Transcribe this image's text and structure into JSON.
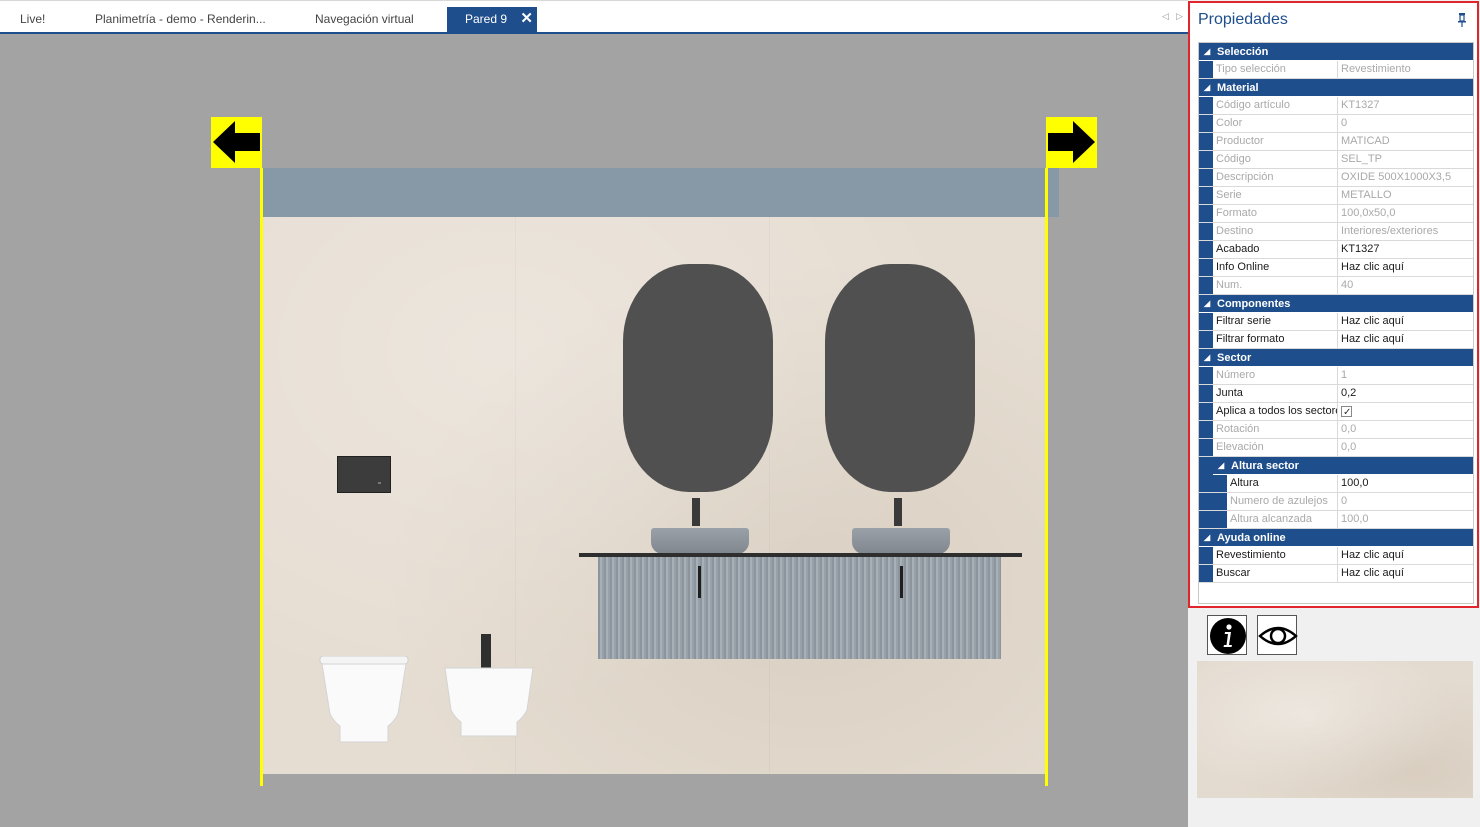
{
  "tabs": [
    {
      "label": "Live!"
    },
    {
      "label": "Planimetría - demo - Renderin..."
    },
    {
      "label": "Navegación virtual"
    },
    {
      "label": "Pared 9",
      "active": true
    }
  ],
  "tab_close_glyph": "✕",
  "scroll_glyphs": {
    "left": "◁",
    "right": "▷"
  },
  "colors": {
    "accent": "#1f4e8c",
    "highlight_border": "#e0262c",
    "guide_yellow": "#ffff00",
    "viewport_bg": "#a3a3a3",
    "wall_tile": "#e6ddd2",
    "wall_band": "#8798a6"
  },
  "panel": {
    "title": "Propiedades",
    "pin_icon": "pin-icon",
    "sections": [
      {
        "title": "Selección",
        "rows": [
          {
            "label": "Tipo selección",
            "value": "Revestimiento",
            "disabled": true
          }
        ]
      },
      {
        "title": "Material",
        "rows": [
          {
            "label": "Código artículo",
            "value": "KT1327",
            "disabled": true
          },
          {
            "label": "Color",
            "value": "0",
            "disabled": true
          },
          {
            "label": "Productor",
            "value": "MATICAD",
            "disabled": true
          },
          {
            "label": "Código",
            "value": "SEL_TP",
            "disabled": true
          },
          {
            "label": "Descripción",
            "value": "OXIDE 500X1000X3,5",
            "disabled": true
          },
          {
            "label": "Serie",
            "value": "METALLO",
            "disabled": true
          },
          {
            "label": "Formato",
            "value": "100,0x50,0",
            "disabled": true
          },
          {
            "label": "Destino",
            "value": "Interiores/exteriores",
            "disabled": true
          },
          {
            "label": "Acabado",
            "value": "KT1327",
            "disabled": false
          },
          {
            "label": "Info Online",
            "value": "Haz clic aquí",
            "disabled": false
          },
          {
            "label": "Num.",
            "value": "40",
            "disabled": true
          }
        ]
      },
      {
        "title": "Componentes",
        "rows": [
          {
            "label": "Filtrar serie",
            "value": "Haz clic aquí",
            "disabled": false
          },
          {
            "label": "Filtrar formato",
            "value": "Haz clic aquí",
            "disabled": false
          }
        ]
      },
      {
        "title": "Sector",
        "rows": [
          {
            "label": "Número",
            "value": "1",
            "disabled": true
          },
          {
            "label": "Junta",
            "value": "0,2",
            "disabled": false
          },
          {
            "label": "Aplica a todos los sectores",
            "value": "",
            "checked": true,
            "disabled": false
          },
          {
            "label": "Rotación",
            "value": "0,0",
            "disabled": true
          },
          {
            "label": "Elevación",
            "value": "0,0",
            "disabled": true
          }
        ],
        "subsection": {
          "title": "Altura sector",
          "rows": [
            {
              "label": "Altura",
              "value": "100,0",
              "disabled": false
            },
            {
              "label": "Numero de azulejos",
              "value": "0",
              "disabled": true
            },
            {
              "label": "Altura alcanzada",
              "value": "100,0",
              "disabled": true
            }
          ]
        }
      },
      {
        "title": "Ayuda online",
        "rows": [
          {
            "label": "Revestimiento",
            "value": "Haz clic aquí",
            "disabled": false
          },
          {
            "label": "Buscar",
            "value": "Haz clic aquí",
            "disabled": false
          }
        ]
      }
    ]
  },
  "tools": [
    {
      "icon": "info-icon"
    },
    {
      "icon": "eye-icon"
    }
  ]
}
